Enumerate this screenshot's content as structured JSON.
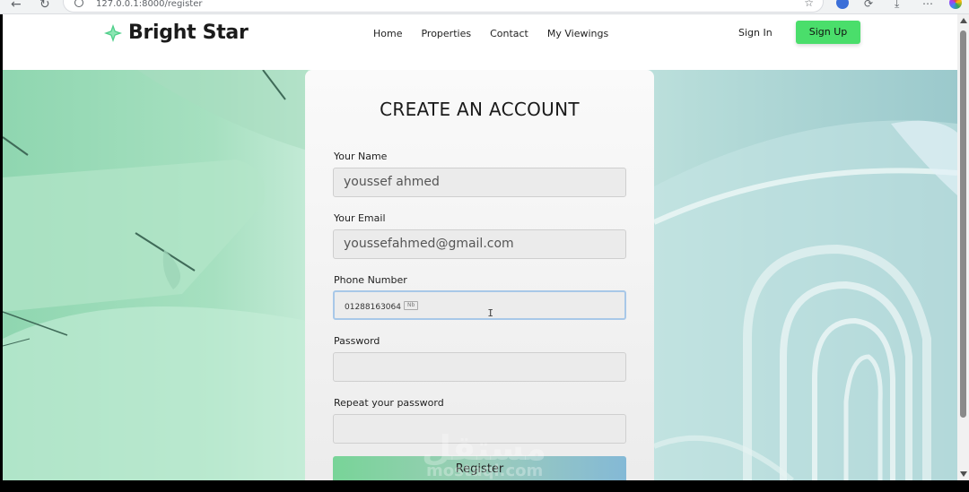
{
  "browser": {
    "url": "127.0.0.1:8000/register",
    "back_glyph": "←",
    "reload_glyph": "↻",
    "star_glyph": "☆",
    "download_glyph": "⤓",
    "menu_glyph": "⋯"
  },
  "header": {
    "brand": "Bright Star",
    "nav": [
      "Home",
      "Properties",
      "Contact",
      "My Viewings"
    ],
    "sign_in": "Sign In",
    "sign_up": "Sign Up"
  },
  "form": {
    "title": "CREATE AN ACCOUNT",
    "name_label": "Your Name",
    "name_value": "youssef ahmed",
    "email_label": "Your Email",
    "email_value": "youssefahmed@gmail.com",
    "phone_label": "Phone Number",
    "phone_value": "01288163064",
    "phone_badge": "Nb",
    "password_label": "Password",
    "password_value": "",
    "repeat_label": "Repeat your password",
    "repeat_value": "",
    "register_label": "Register",
    "cursor_glyph": "I"
  },
  "watermark": {
    "arabic": "مستقل",
    "latin": "mostaql.com"
  },
  "colors": {
    "accent_green": "#4ade6b",
    "hero_left": "#8fd6b0",
    "hero_right": "#9bc9cc"
  }
}
